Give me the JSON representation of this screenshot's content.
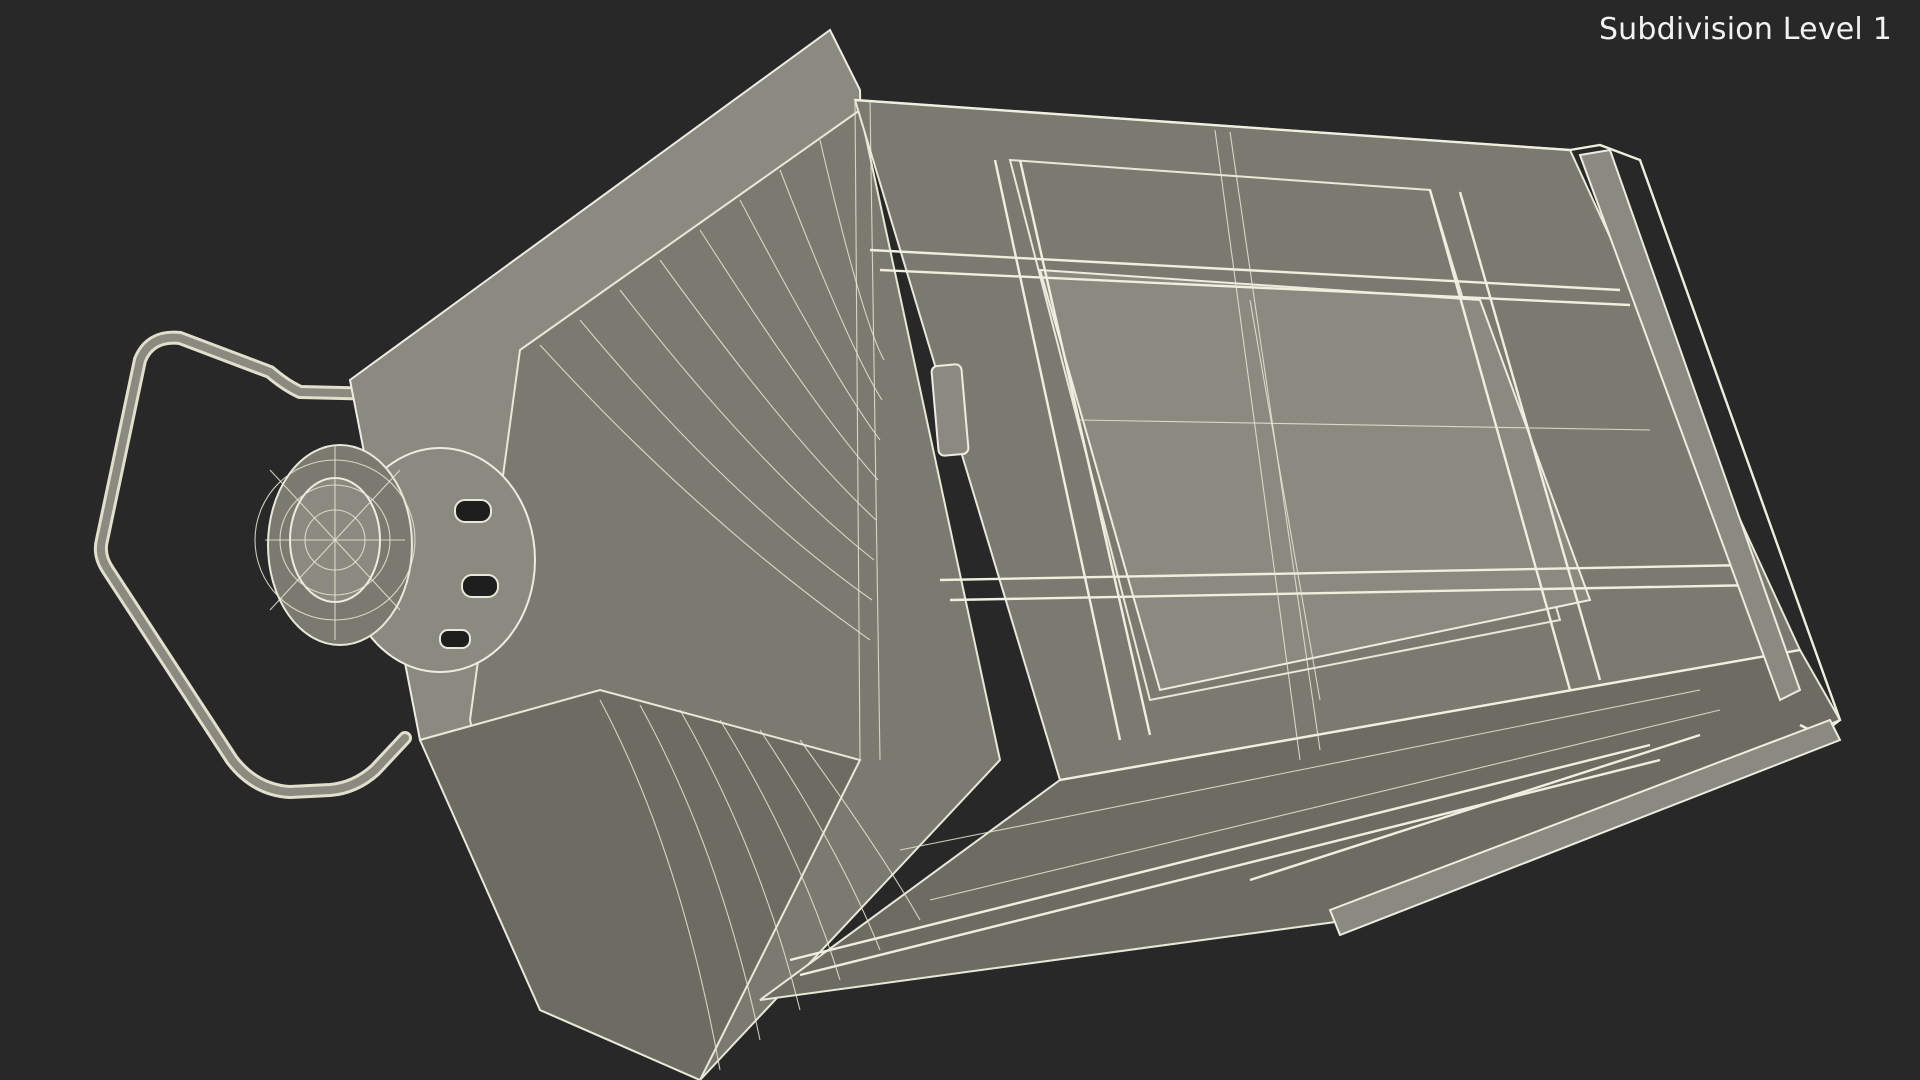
{
  "render": {
    "label": "Subdivision Level 1",
    "background_color": "#282828",
    "wire_color": "#e8e8d8",
    "surface_color": "#7a7a70"
  }
}
